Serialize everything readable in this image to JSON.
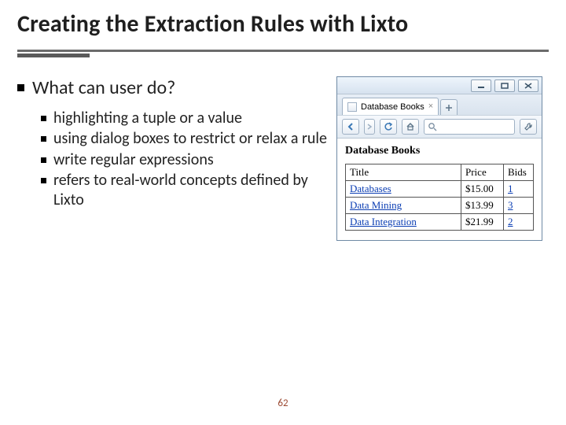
{
  "title": "Creating the Extraction Rules with Lixto",
  "question": "What can user do?",
  "bullets": [
    "highlighting a tuple or a value",
    "using dialog boxes to restrict or relax a rule",
    "write regular expressions",
    "refers to real-world concepts defined by Lixto"
  ],
  "browser": {
    "tab_label": "Database Books",
    "page_heading": "Database Books",
    "table": {
      "headers": [
        "Title",
        "Price",
        "Bids"
      ],
      "rows": [
        {
          "title": "Databases",
          "price": "$15.00",
          "bids": "1"
        },
        {
          "title": "Data Mining",
          "price": "$13.99",
          "bids": "3"
        },
        {
          "title": "Data Integration",
          "price": "$21.99",
          "bids": "2"
        }
      ]
    }
  },
  "page_number": "62"
}
